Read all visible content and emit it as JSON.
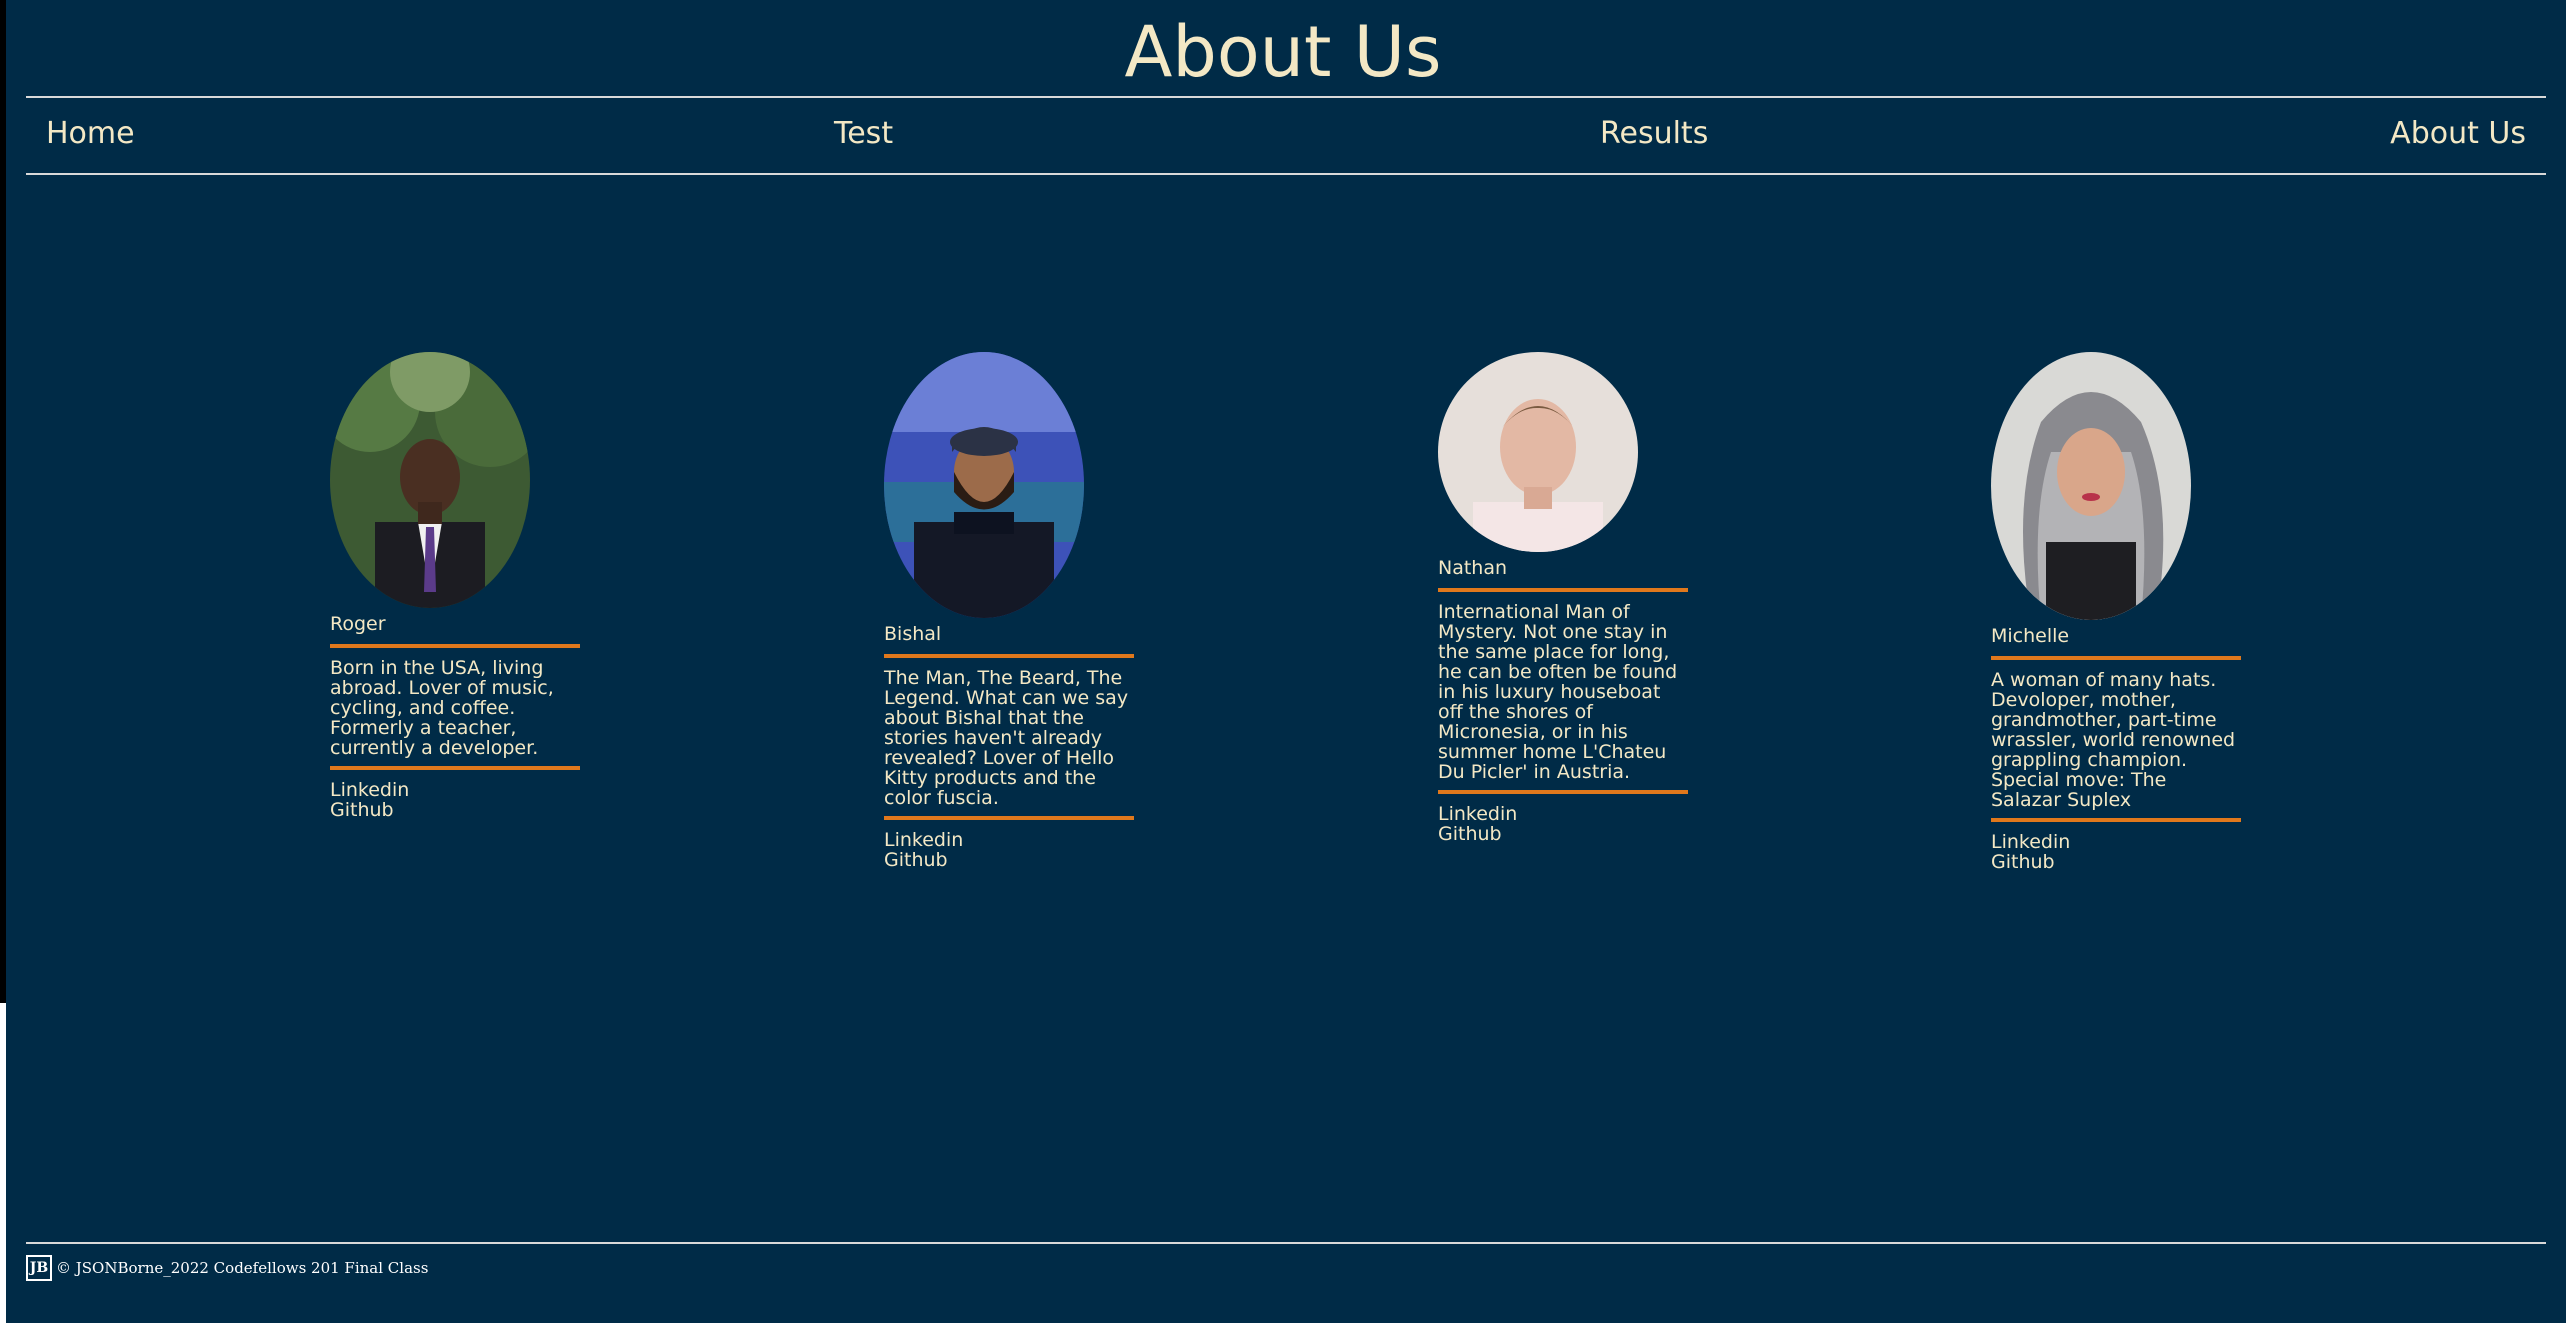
{
  "page": {
    "title": "About Us"
  },
  "nav": {
    "items": [
      {
        "label": "Home"
      },
      {
        "label": "Test"
      },
      {
        "label": "Results"
      },
      {
        "label": "About Us"
      }
    ]
  },
  "team": [
    {
      "name": "Roger",
      "bio": "Born in the USA, living abroad. Lover of music, cycling, and coffee. Formerly a teacher, currently a developer.",
      "links": [
        "Linkedin",
        "Github"
      ]
    },
    {
      "name": "Bishal",
      "bio": "The Man, The Beard, The Legend. What can we say about Bishal that the stories haven't already revealed? Lover of Hello Kitty products and the color fuscia.",
      "links": [
        "Linkedin",
        "Github"
      ]
    },
    {
      "name": "Nathan",
      "bio": "International Man of Mystery. Not one stay in the same place for long, he can be often be found in his luxury houseboat off the shores of Micronesia, or in his summer home L'Chateu Du Picler' in Austria.",
      "links": [
        "Linkedin",
        "Github"
      ]
    },
    {
      "name": "Michelle",
      "bio": "A woman of many hats. Devoloper, mother, grandmother, part-time wrassler, world renowned grappling champion. Special move: The Salazar Suplex",
      "links": [
        "Linkedin",
        "Github"
      ]
    }
  ],
  "footer": {
    "logo_text": "JB",
    "text": "© JSONBorne_2022 Codefellows 201 Final Class"
  },
  "colors": {
    "background": "#002b47",
    "text": "#f3e8c5",
    "accent": "#e0781c",
    "rule": "#d9d9d9"
  }
}
